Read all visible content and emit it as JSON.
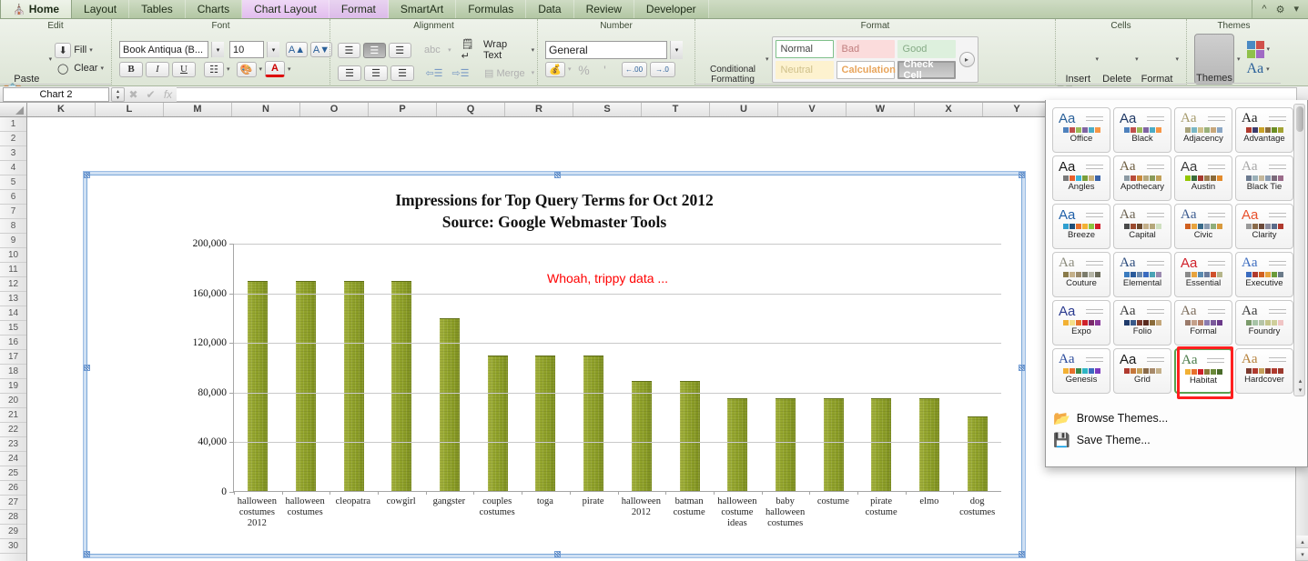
{
  "tabbar": {
    "tabs": [
      {
        "label": "Home",
        "icon": "home-icon",
        "state": "active"
      },
      {
        "label": "Layout",
        "state": "normal"
      },
      {
        "label": "Tables",
        "state": "normal"
      },
      {
        "label": "Charts",
        "state": "normal"
      },
      {
        "label": "Chart Layout",
        "state": "context-selected"
      },
      {
        "label": "Format",
        "state": "context"
      },
      {
        "label": "SmartArt",
        "state": "normal"
      },
      {
        "label": "Formulas",
        "state": "normal"
      },
      {
        "label": "Data",
        "state": "normal"
      },
      {
        "label": "Review",
        "state": "normal"
      },
      {
        "label": "Developer",
        "state": "normal"
      }
    ],
    "collapse_icon": "chevron-up-icon",
    "gear_icon": "gear-icon",
    "gear_caret": "▾"
  },
  "ribbon": {
    "groups": [
      {
        "title": "Edit"
      },
      {
        "title": "Font"
      },
      {
        "title": "Alignment"
      },
      {
        "title": "Number"
      },
      {
        "title": "Format"
      },
      {
        "title": "Cells"
      },
      {
        "title": "Themes"
      }
    ],
    "edit": {
      "paste_label": "Paste",
      "fill_label": "Fill",
      "clear_label": "Clear",
      "caret": "▾"
    },
    "font": {
      "family_value": "Book Antiqua (B...",
      "size_value": "10",
      "grow_label": "A",
      "shrink_label": "A",
      "bold_label": "B",
      "italic_label": "I",
      "underline_label": "U",
      "fill_color_label": "A",
      "caret": "▾"
    },
    "alignment": {
      "orientation_label": "abc",
      "wrap_label": "Wrap Text",
      "merge_label": "Merge",
      "caret": "▾"
    },
    "number": {
      "format_value": "General",
      "percent_label": "%",
      "comma_label": "'",
      "dec_inc_label": ".00",
      "dec_dec_label": ".00",
      "caret": "▾"
    },
    "format": {
      "conditional_label_1": "Conditional",
      "conditional_label_2": "Formatting",
      "styles": [
        "Normal",
        "Bad",
        "Good",
        "Neutral",
        "Calculation",
        "Check Cell"
      ],
      "more_caret": "▸",
      "caret": "▾"
    },
    "cells": {
      "insert_label": "Insert",
      "delete_label": "Delete",
      "format_label": "Format",
      "caret": "▾"
    },
    "themes": {
      "themes_label": "Themes",
      "colors_label": "",
      "fonts_label": "Aa",
      "caret": "▾"
    }
  },
  "formula_bar": {
    "name_box_value": "Chart 2",
    "cancel_icon": "cancel-icon",
    "confirm_icon": "confirm-icon",
    "function_icon": "fx",
    "formula_value": "",
    "spinner_up": "▴",
    "spinner_down": "▾"
  },
  "grid": {
    "columns": [
      "K",
      "L",
      "M",
      "N",
      "O",
      "P",
      "Q",
      "R",
      "S",
      "T",
      "U",
      "V",
      "W",
      "X",
      "Y"
    ],
    "rows": [
      1,
      2,
      3,
      4,
      5,
      6,
      7,
      8,
      9,
      10,
      11,
      12,
      13,
      14,
      15,
      16,
      17,
      18,
      19,
      20,
      21,
      22,
      23,
      24,
      25,
      26,
      27,
      28,
      29,
      30
    ]
  },
  "scrollbar": {
    "up_arrow": "▴",
    "down_arrow": "▾"
  },
  "themes_popup": {
    "cards": [
      {
        "name": "Office",
        "aa": "Aa",
        "aa_color": "#2a6099",
        "aa_font": "sans",
        "swatches": [
          "#4f81bd",
          "#c0504d",
          "#9bbb59",
          "#8064a2",
          "#4bacc6",
          "#f79646"
        ]
      },
      {
        "name": "Black",
        "aa": "Aa",
        "aa_color": "#1f3864",
        "aa_font": "sans",
        "swatches": [
          "#4f81bd",
          "#c0504d",
          "#9bbb59",
          "#8064a2",
          "#4bacc6",
          "#f79646"
        ]
      },
      {
        "name": "Adjacency",
        "aa": "Aa",
        "aa_color": "#a59a6b",
        "aa_font": "serif",
        "swatches": [
          "#a8a37b",
          "#78b6c4",
          "#cfc08a",
          "#9ab17b",
          "#c7a77b",
          "#8aa6c4"
        ]
      },
      {
        "name": "Advantage",
        "aa": "Aa",
        "aa_color": "#1a1a1a",
        "aa_font": "serif",
        "swatches": [
          "#b03a2e",
          "#3b3b6b",
          "#c9a227",
          "#8a6d3b",
          "#6b8e23",
          "#a3a333"
        ]
      },
      {
        "name": "Angles",
        "aa": "Aa",
        "aa_color": "#1a1a1a",
        "aa_font": "sans",
        "swatches": [
          "#797979",
          "#e8602c",
          "#39b3d7",
          "#7a9e3a",
          "#c9b07b",
          "#3a63a8"
        ]
      },
      {
        "name": "Apothecary",
        "aa": "Aa",
        "aa_color": "#6b5b3e",
        "aa_font": "serif",
        "swatches": [
          "#8c9aa3",
          "#b84b3a",
          "#c98a3a",
          "#b5a77b",
          "#8a9b5b",
          "#c2a15a"
        ]
      },
      {
        "name": "Austin",
        "aa": "Aa",
        "aa_color": "#3a3a3a",
        "aa_font": "sans",
        "swatches": [
          "#94c600",
          "#3a6b3a",
          "#a63a2e",
          "#9a7b4f",
          "#8a6b3a",
          "#e38b2c"
        ]
      },
      {
        "name": "Black Tie",
        "aa": "Aa",
        "aa_color": "#a6a6a6",
        "aa_font": "serif",
        "swatches": [
          "#6b7a8f",
          "#9ab0b8",
          "#c4b79b",
          "#8a9bb0",
          "#7b6b7b",
          "#9b6b8a"
        ]
      },
      {
        "name": "Breeze",
        "aa": "Aa",
        "aa_color": "#1f5fa8",
        "aa_font": "sans",
        "swatches": [
          "#2f9fd0",
          "#1f4e79",
          "#e8702c",
          "#f2b134",
          "#8ac63f",
          "#d0202a"
        ]
      },
      {
        "name": "Capital",
        "aa": "Aa",
        "aa_color": "#6b6150",
        "aa_font": "serif",
        "swatches": [
          "#4a4a4a",
          "#9b4a2e",
          "#6b4a2e",
          "#c4b08a",
          "#b5a77b",
          "#cfe0c0"
        ]
      },
      {
        "name": "Civic",
        "aa": "Aa",
        "aa_color": "#3a5a8f",
        "aa_font": "serif",
        "swatches": [
          "#d06020",
          "#e8a33d",
          "#3a6b8a",
          "#8a9bb0",
          "#8fae7b",
          "#d89a3d"
        ]
      },
      {
        "name": "Clarity",
        "aa": "Aa",
        "aa_color": "#e8502c",
        "aa_font": "sans",
        "swatches": [
          "#9a9a9a",
          "#8a6b4a",
          "#6b4a3a",
          "#8a8a9b",
          "#5a6b8a",
          "#b03a2e"
        ]
      },
      {
        "name": "Couture",
        "aa": "Aa",
        "aa_color": "#8a8a7b",
        "aa_font": "serif",
        "swatches": [
          "#8a7b4a",
          "#c4b08a",
          "#9a8a6b",
          "#7b7b6b",
          "#b5b5a7",
          "#6b6b5a"
        ]
      },
      {
        "name": "Elemental",
        "aa": "Aa",
        "aa_color": "#2a4a7b",
        "aa_font": "serif",
        "swatches": [
          "#3a7bbf",
          "#2a5a9b",
          "#6b8ab0",
          "#3a6bbf",
          "#4aa3b5",
          "#9b8ab0"
        ]
      },
      {
        "name": "Essential",
        "aa": "Aa",
        "aa_color": "#d0202a",
        "aa_font": "sans",
        "swatches": [
          "#8a8a8a",
          "#e8a33d",
          "#5a8ab0",
          "#6b7b9b",
          "#d0502a",
          "#b5b58a"
        ]
      },
      {
        "name": "Executive",
        "aa": "Aa",
        "aa_color": "#3a6bbf",
        "aa_font": "serif",
        "swatches": [
          "#3a6bbf",
          "#b03a2e",
          "#d06020",
          "#e8a33d",
          "#6b9b3a",
          "#6b7b8a"
        ]
      },
      {
        "name": "Expo",
        "aa": "Aa",
        "aa_color": "#2a3a8f",
        "aa_font": "sans",
        "swatches": [
          "#f2b134",
          "#f5e08a",
          "#e8702c",
          "#d0202a",
          "#7b2a6b",
          "#8a3a9b"
        ]
      },
      {
        "name": "Folio",
        "aa": "Aa",
        "aa_color": "#3a3a3a",
        "aa_font": "serif",
        "swatches": [
          "#1f3a6b",
          "#3a5a8a",
          "#7b3a2e",
          "#5a2a1f",
          "#8a6b3a",
          "#c4a77b"
        ]
      },
      {
        "name": "Formal",
        "aa": "Aa",
        "aa_color": "#7b6b5a",
        "aa_font": "serif",
        "swatches": [
          "#9b7b6b",
          "#c4a08a",
          "#b5806b",
          "#8a7bb0",
          "#7b5a9b",
          "#6b3a8a"
        ]
      },
      {
        "name": "Foundry",
        "aa": "Aa",
        "aa_color": "#3a3a3a",
        "aa_font": "serif",
        "swatches": [
          "#7b9b6b",
          "#a7c4a7",
          "#b5c4a7",
          "#c4c48a",
          "#cfcf9b",
          "#f0c4c4"
        ]
      },
      {
        "name": "Genesis",
        "aa": "Aa",
        "aa_color": "#2a4a9b",
        "aa_font": "serif",
        "swatches": [
          "#f2b134",
          "#e8702c",
          "#3a8a4a",
          "#2fb5c4",
          "#3a6bbf",
          "#7b3abf"
        ]
      },
      {
        "name": "Grid",
        "aa": "Aa",
        "aa_color": "#1a1a1a",
        "aa_font": "sans",
        "swatches": [
          "#b03a2e",
          "#c4763a",
          "#c4a05a",
          "#8a6b4a",
          "#a78a6b",
          "#c4b08a"
        ]
      },
      {
        "name": "Habitat",
        "aa": "Aa",
        "aa_color": "#4a7b4a",
        "aa_font": "serif",
        "swatches": [
          "#f2b134",
          "#e8702c",
          "#d0202a",
          "#8a7b3a",
          "#6b8a3a",
          "#4a6b2a"
        ],
        "selected": true,
        "annotated": true
      },
      {
        "name": "Hardcover",
        "aa": "Aa",
        "aa_color": "#b5803a",
        "aa_font": "serif",
        "swatches": [
          "#7b3a2e",
          "#b03a2e",
          "#c4a05a",
          "#8a3a2e",
          "#b03a2e",
          "#9b3a2e"
        ]
      }
    ],
    "browse_label": "Browse Themes...",
    "browse_icon": "folder-icon",
    "save_label": "Save Theme...",
    "save_icon": "floppy-disk-icon",
    "scroll_up": "▴",
    "scroll_down": "▾",
    "highlight_color": "#ff1f1f"
  },
  "chart_data": {
    "type": "bar",
    "title": "Impressions for Top Query Terms for Oct 2012\nSource: Google Webmaster Tools",
    "title_line1": "Impressions for Top Query Terms for Oct 2012",
    "title_line2": "Source: Google Webmaster Tools",
    "annotation": "Whoah, trippy data ...",
    "annotation_color": "#ff0000",
    "bar_color": "#8b9d26",
    "xlabel": "",
    "ylabel": "",
    "ylim": [
      0,
      200000
    ],
    "yticks": [
      0,
      40000,
      80000,
      120000,
      160000,
      200000
    ],
    "ytick_labels": [
      "0",
      "40,000",
      "80,000",
      "120,000",
      "160,000",
      "200,000"
    ],
    "grid": true,
    "legend": "none",
    "categories": [
      "halloween costumes 2012",
      "halloween costumes",
      "cleopatra",
      "cowgirl",
      "gangster",
      "couples costumes",
      "toga",
      "pirate",
      "halloween 2012",
      "batman costume",
      "halloween costume ideas",
      "baby halloween costumes",
      "costume",
      "pirate costume",
      "elmo",
      "dog costumes"
    ],
    "values": [
      169000,
      169500,
      169500,
      169500,
      139000,
      109000,
      109000,
      109000,
      89000,
      89000,
      75000,
      75000,
      75000,
      75000,
      75000,
      60000
    ]
  }
}
